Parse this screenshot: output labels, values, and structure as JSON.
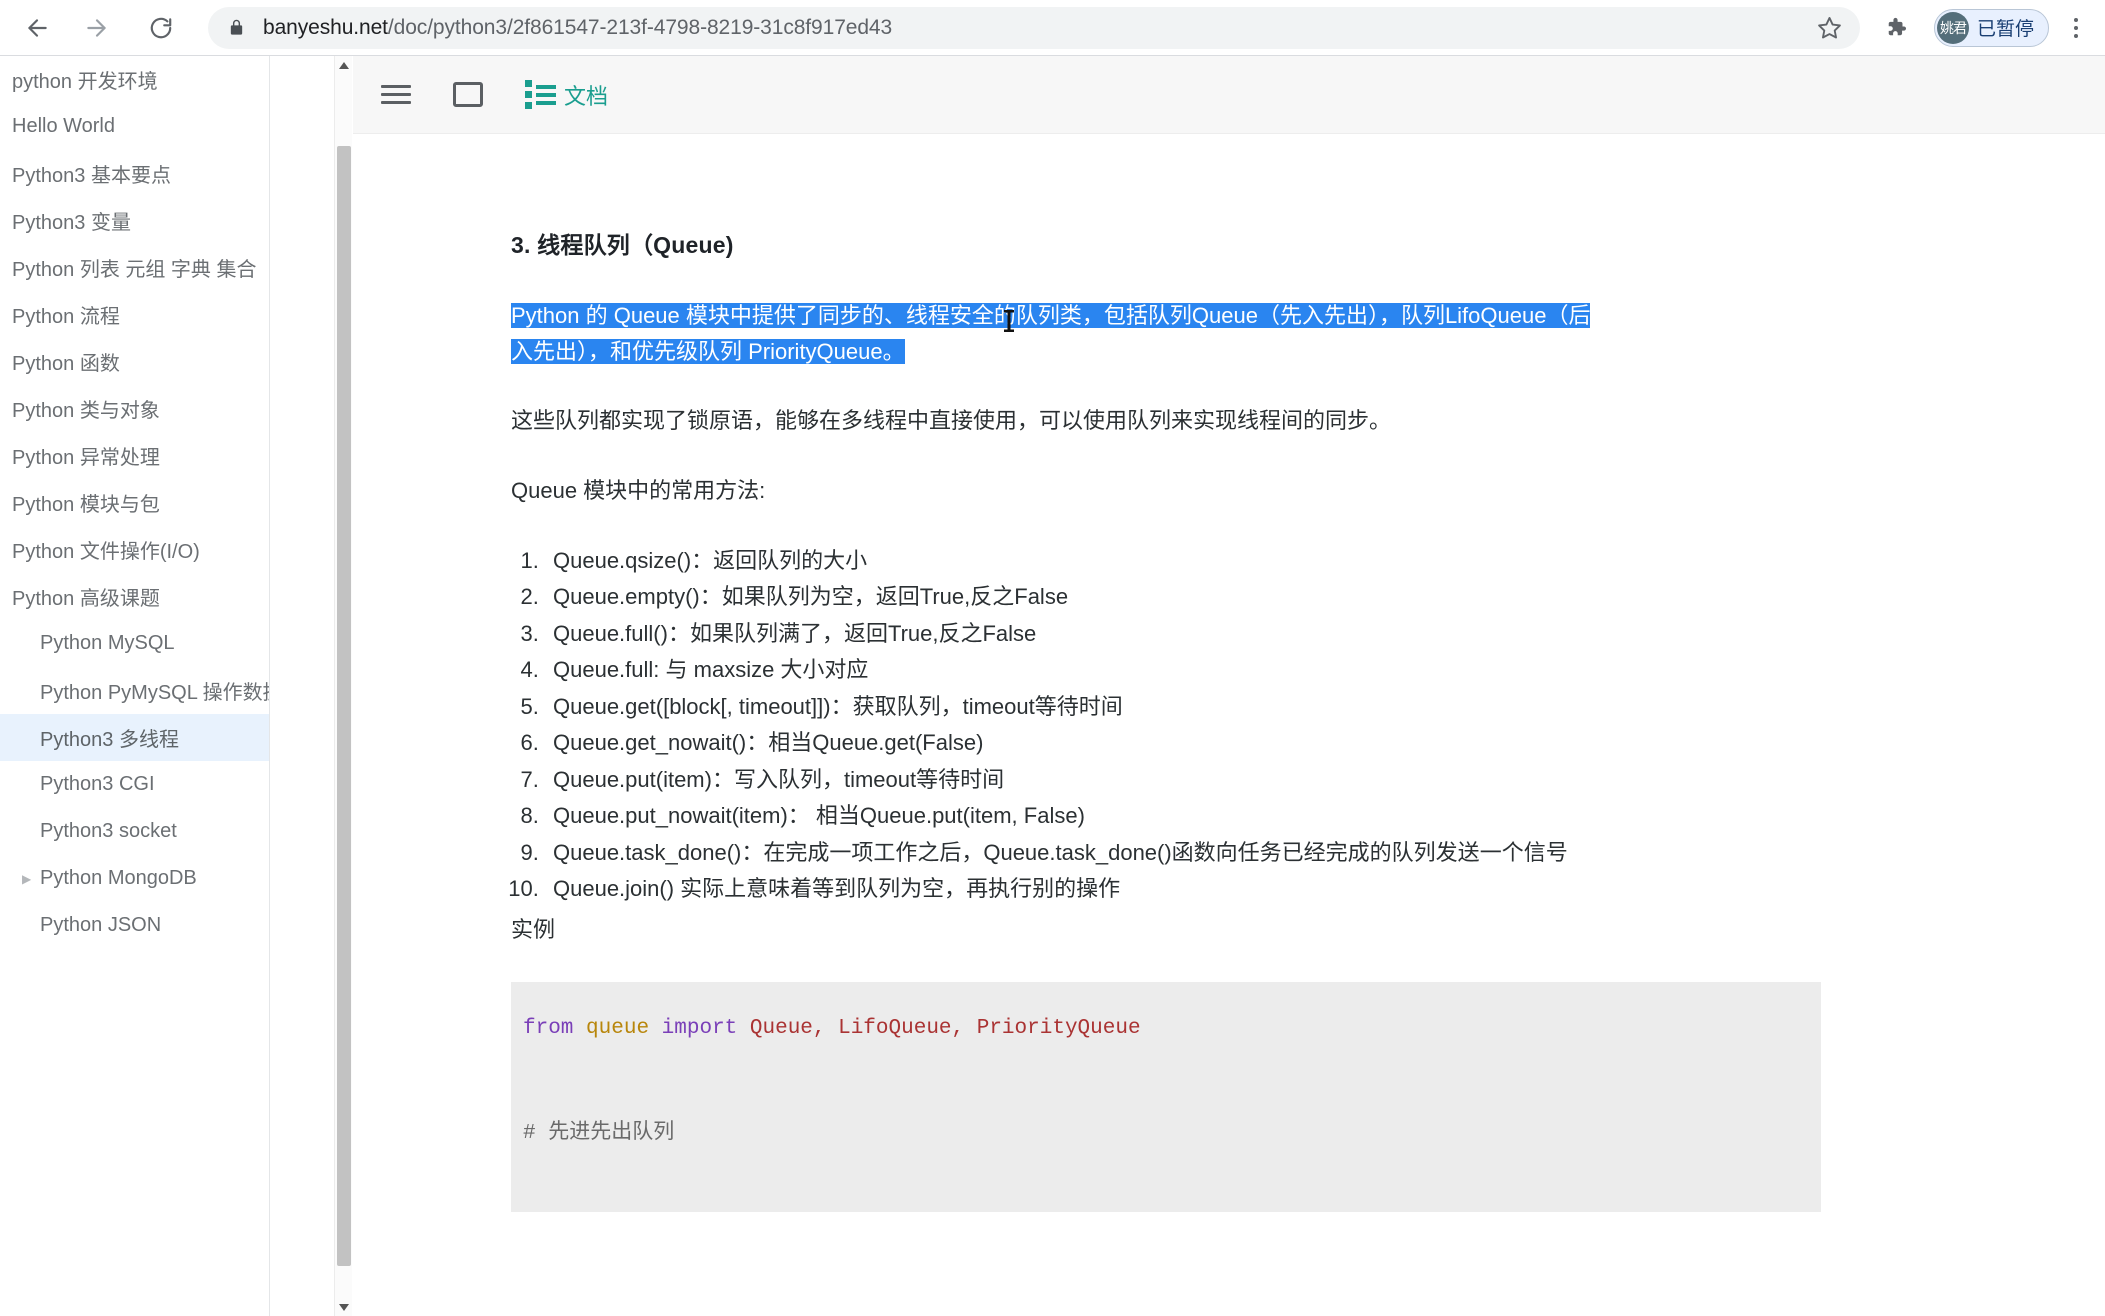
{
  "browser": {
    "url_prefix": "banyeshu.net",
    "url_path": "/doc/python3/2f861547-213f-4798-8219-31c8f917ed43",
    "back_icon": "back-arrow-icon",
    "forward_icon": "forward-arrow-icon",
    "reload_icon": "reload-icon",
    "lock_icon": "lock-icon",
    "star_icon": "bookmark-star-icon",
    "extensions_icon": "puzzle-piece-icon",
    "profile_initials": "姚君",
    "profile_status": "已暂停",
    "menu_icon": "kebab-menu-icon"
  },
  "sidebar": {
    "items": [
      {
        "label": "python 开发环境",
        "indent": false,
        "active": false,
        "caret": false
      },
      {
        "label": "Hello World",
        "indent": false,
        "active": false,
        "caret": false
      },
      {
        "label": "Python3 基本要点",
        "indent": false,
        "active": false,
        "caret": false
      },
      {
        "label": "Python3 变量",
        "indent": false,
        "active": false,
        "caret": false
      },
      {
        "label": "Python 列表 元组 字典 集合",
        "indent": false,
        "active": false,
        "caret": false
      },
      {
        "label": "Python 流程",
        "indent": false,
        "active": false,
        "caret": false
      },
      {
        "label": "Python 函数",
        "indent": false,
        "active": false,
        "caret": false
      },
      {
        "label": "Python 类与对象",
        "indent": false,
        "active": false,
        "caret": false
      },
      {
        "label": "Python 异常处理",
        "indent": false,
        "active": false,
        "caret": false
      },
      {
        "label": "Python 模块与包",
        "indent": false,
        "active": false,
        "caret": false
      },
      {
        "label": "Python 文件操作(I/O)",
        "indent": false,
        "active": false,
        "caret": false
      },
      {
        "label": "Python 高级课题",
        "indent": false,
        "active": false,
        "caret": false
      },
      {
        "label": "Python MySQL",
        "indent": true,
        "active": false,
        "caret": false
      },
      {
        "label": "Python PyMySQL 操作数据库",
        "indent": true,
        "active": false,
        "caret": false
      },
      {
        "label": "Python3 多线程",
        "indent": true,
        "active": true,
        "caret": false
      },
      {
        "label": "Python3 CGI",
        "indent": true,
        "active": false,
        "caret": false
      },
      {
        "label": "Python3 socket",
        "indent": true,
        "active": false,
        "caret": false
      },
      {
        "label": "Python MongoDB",
        "indent": true,
        "active": false,
        "caret": true
      },
      {
        "label": "Python JSON",
        "indent": true,
        "active": false,
        "caret": false
      }
    ],
    "scrollbar": {
      "up_icon": "scroll-up-arrow-icon",
      "down_icon": "scroll-down-arrow-icon"
    }
  },
  "doc_toolbar": {
    "menu_icon": "hamburger-menu-icon",
    "window_icon": "window-frame-icon",
    "doc_icon": "document-list-icon",
    "doc_label": "文档"
  },
  "document": {
    "heading": "3. 线程队列（Queue)",
    "selected_paragraph": "Python 的 Queue 模块中提供了同步的、线程安全的队列类，包括队列Queue（先入先出），队列LifoQueue（后入先出），和优先级队列 PriorityQueue。",
    "paragraph_2": "这些队列都实现了锁原语，能够在多线程中直接使用，可以使用队列来实现线程间的同步。",
    "paragraph_3": "Queue 模块中的常用方法:",
    "list_items": [
      "Queue.qsize()：返回队列的大小",
      "Queue.empty()：如果队列为空，返回True,反之False",
      "Queue.full()：如果队列满了，返回True,反之False",
      "Queue.full:   与 maxsize 大小对应",
      "Queue.get([block[, timeout]])：获取队列，timeout等待时间",
      "Queue.get_nowait()：相当Queue.get(False)",
      "Queue.put(item)：写入队列，timeout等待时间",
      "Queue.put_nowait(item)： 相当Queue.put(item, False)",
      "Queue.task_done()：在完成一项工作之后，Queue.task_done()函数向任务已经完成的队列发送一个信号",
      "Queue.join() 实际上意味着等到队列为空，再执行别的操作"
    ],
    "example_label": "实例",
    "code": {
      "line1_kw1": "from",
      "line1_mod": "queue",
      "line1_kw2": "import",
      "line1_names": "Queue, LifoQueue, PriorityQueue",
      "comment": "# 先进先出队列"
    }
  },
  "colors": {
    "selection_blue": "#2a85f0",
    "accent_teal": "#1a9e8f",
    "sidebar_active": "#e8f2fd",
    "code_bg": "#ececec"
  }
}
